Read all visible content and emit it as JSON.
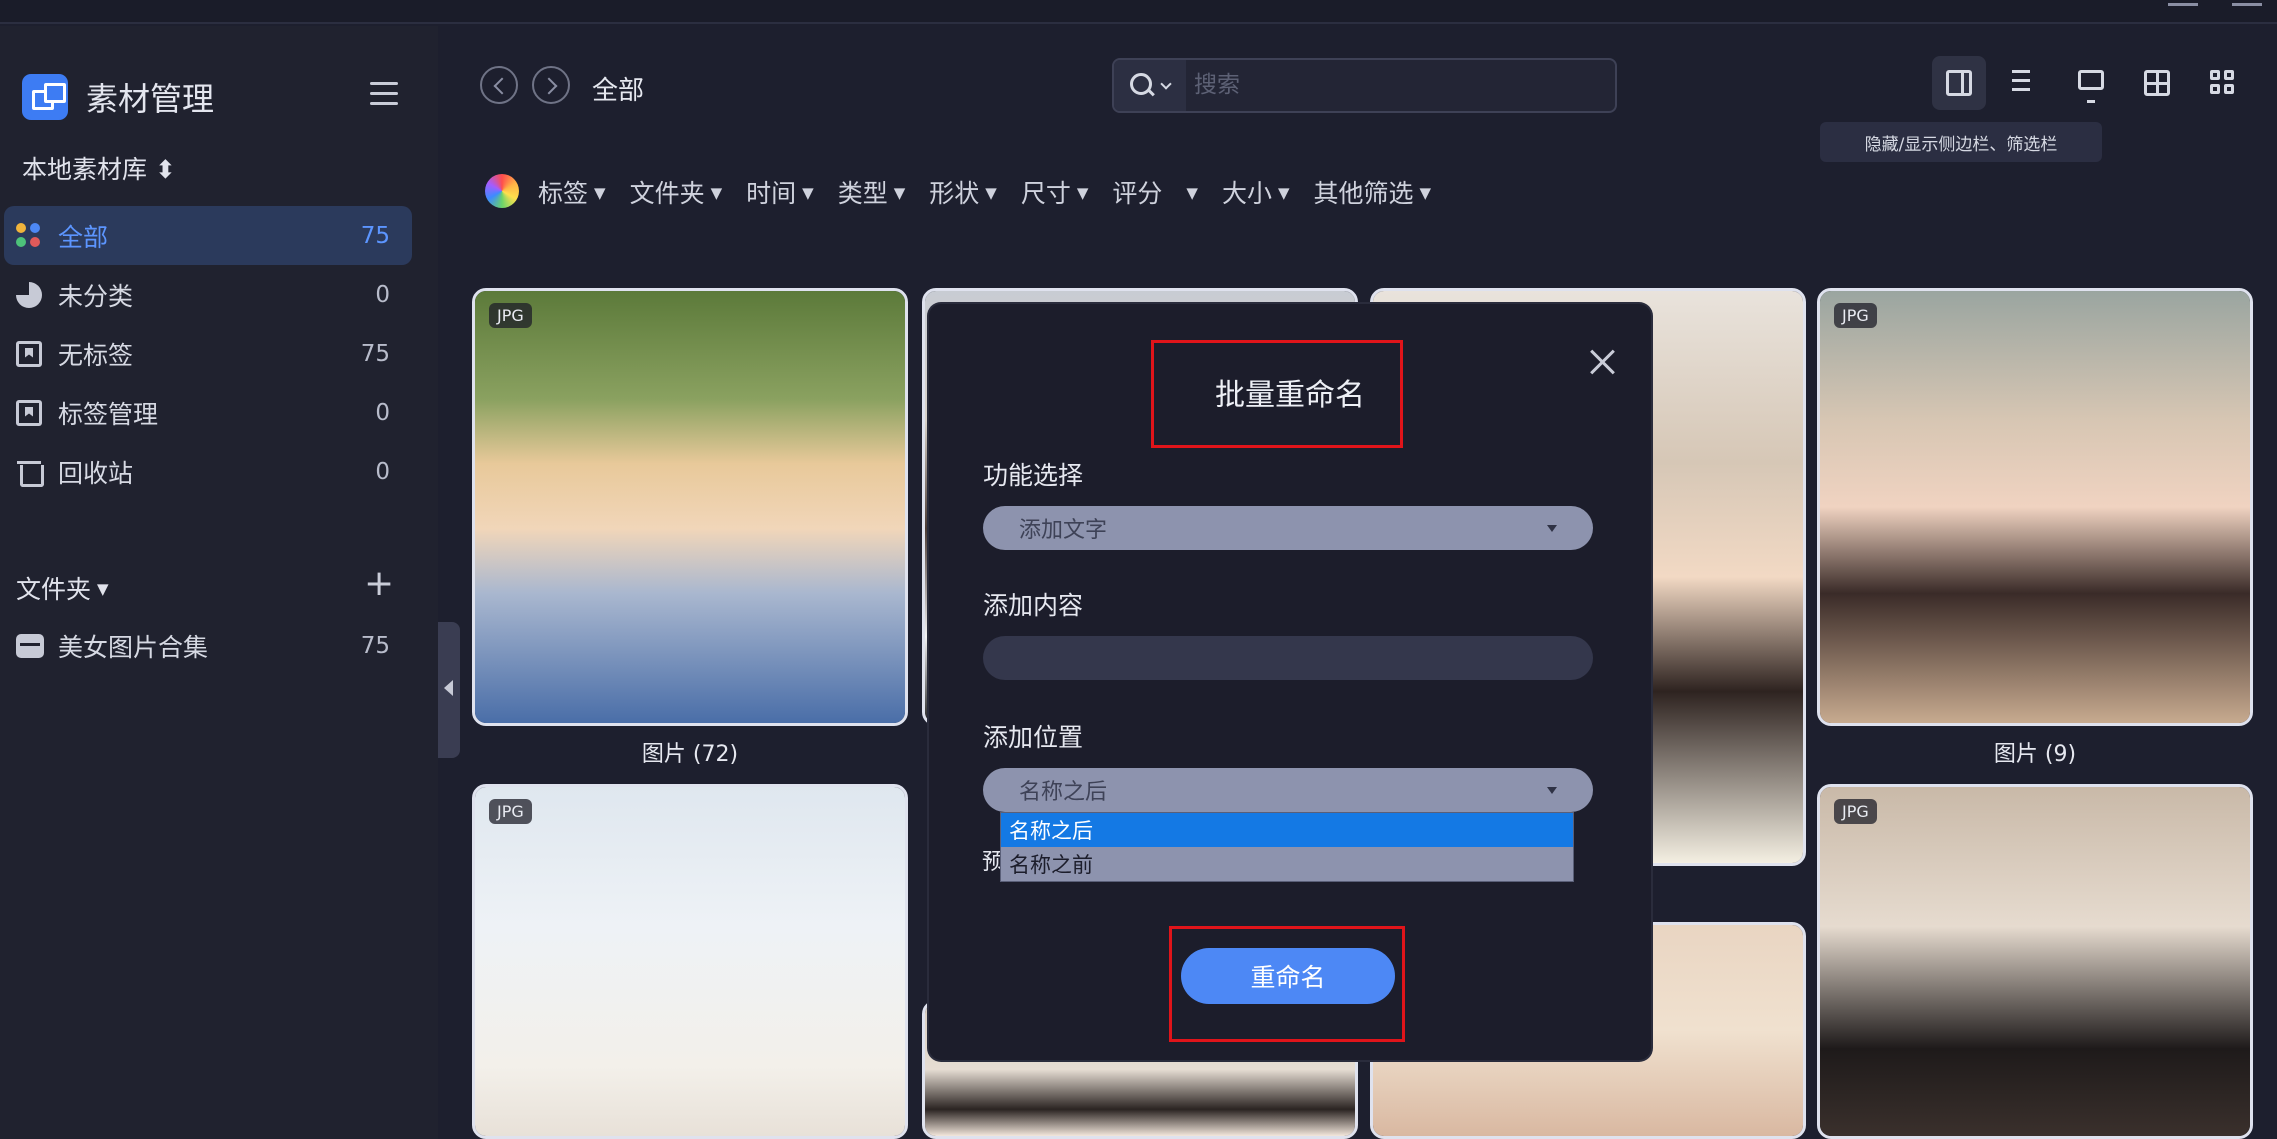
{
  "window": {
    "title_bar_buttons": [
      "minimize",
      "close"
    ]
  },
  "sidebar": {
    "brand": "素材管理",
    "library_selector": "本地素材库 ⬍",
    "nav": [
      {
        "label": "全部",
        "count": "75",
        "icon": "grid-dots-icon",
        "active": true
      },
      {
        "label": "未分类",
        "count": "0",
        "icon": "pie-icon"
      },
      {
        "label": "无标签",
        "count": "75",
        "icon": "bookmark-icon"
      },
      {
        "label": "标签管理",
        "count": "0",
        "icon": "tag-manage-icon"
      },
      {
        "label": "回收站",
        "count": "0",
        "icon": "trash-icon"
      }
    ],
    "folders_header": "文件夹",
    "folders": [
      {
        "label": "美女图片合集",
        "count": "75"
      }
    ]
  },
  "header": {
    "breadcrumb": "全部",
    "search_placeholder": "搜索",
    "tooltip": "隐藏/显示侧边栏、筛选栏"
  },
  "filters": [
    "标签",
    "文件夹",
    "时间",
    "类型",
    "形状",
    "尺寸",
    "评分",
    "大小",
    "其他筛选"
  ],
  "grid": {
    "badge": "JPG",
    "captions": [
      "图片 (72)",
      "图片 (9)"
    ]
  },
  "modal": {
    "title": "批量重命名",
    "function_label": "功能选择",
    "function_value": "添加文字",
    "content_label": "添加内容",
    "content_value": "",
    "position_label": "添加位置",
    "position_value": "名称之后",
    "position_options": [
      "名称之后",
      "名称之前"
    ],
    "peek_char": "预",
    "rename_button": "重命名"
  },
  "colors": {
    "accent": "#4d88f5",
    "highlight_box": "#e0141a",
    "selected_option": "#1479e4"
  }
}
